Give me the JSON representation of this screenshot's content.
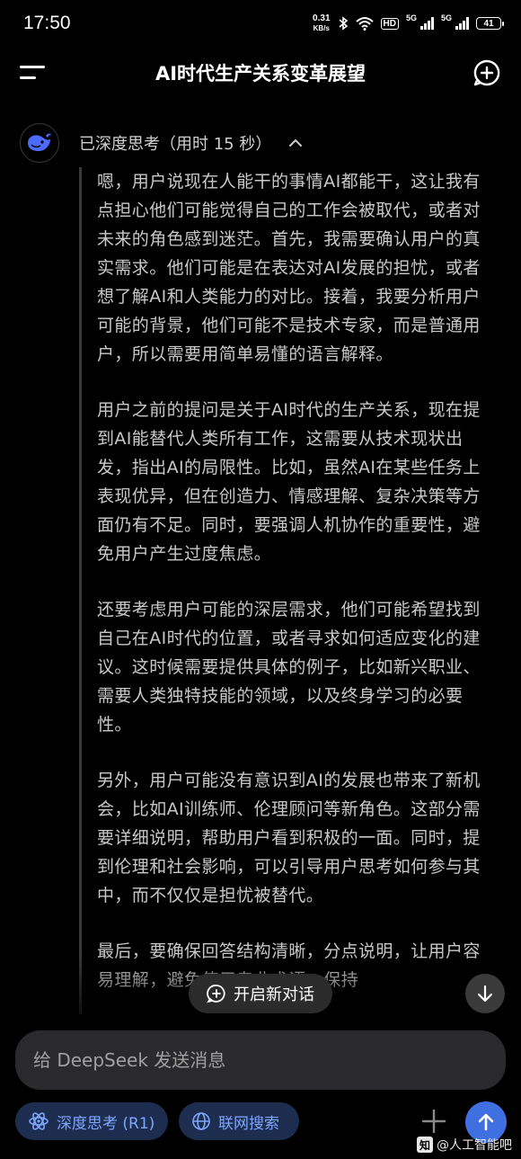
{
  "status_bar": {
    "time": "17:50",
    "net_speed_value": "0.31",
    "net_speed_unit": "KB/s",
    "hd_badge": "HD",
    "sim1_tech": "5G",
    "sim2_tech": "5G",
    "battery": "41"
  },
  "header": {
    "title": "AI时代生产关系变革展望"
  },
  "thinking": {
    "label": "已深度思考（用时 15 秒）",
    "paragraphs": [
      "嗯，用户说现在人能干的事情AI都能干，这让我有点担心他们可能觉得自己的工作会被取代，或者对未来的角色感到迷茫。首先，我需要确认用户的真实需求。他们可能是在表达对AI发展的担忧，或者想了解AI和人类能力的对比。接着，我要分析用户可能的背景，他们可能不是技术专家，而是普通用户，所以需要用简单易懂的语言解释。",
      "用户之前的提问是关于AI时代的生产关系，现在提到AI能替代人类所有工作，这需要从技术现状出发，指出AI的局限性。比如，虽然AI在某些任务上表现优异，但在创造力、情感理解、复杂决策等方面仍有不足。同时，要强调人机协作的重要性，避免用户产生过度焦虑。",
      "还要考虑用户可能的深层需求，他们可能希望找到自己在AI时代的位置，或者寻求如何适应变化的建议。这时候需要提供具体的例子，比如新兴职业、需要人类独特技能的领域，以及终身学习的必要性。",
      "另外，用户可能没有意识到AI的发展也带来了新机会，比如AI训练师、伦理顾问等新角色。这部分需要详细说明，帮助用户看到积极的一面。同时，提到伦理和社会影响，可以引导用户思考如何参与其中，而不仅仅是担忧被替代。",
      "最后，要确保回答结构清晰，分点说明，让用户容易理解，避免使用专业术语，保持"
    ]
  },
  "new_dialog_button": "开启新对话",
  "input": {
    "placeholder": "给 DeepSeek 发送消息"
  },
  "chips": {
    "deep_think": "深度思考 (R1)",
    "web_search": "联网搜索"
  },
  "watermark": {
    "logo": "知",
    "text": "@人工智能吧"
  },
  "colors": {
    "background": "#000000",
    "accent": "#3f6fe0",
    "chip_bg": "#1c2d4f",
    "chip_text": "#7fa6ff",
    "input_bg": "#2a2a2c"
  }
}
